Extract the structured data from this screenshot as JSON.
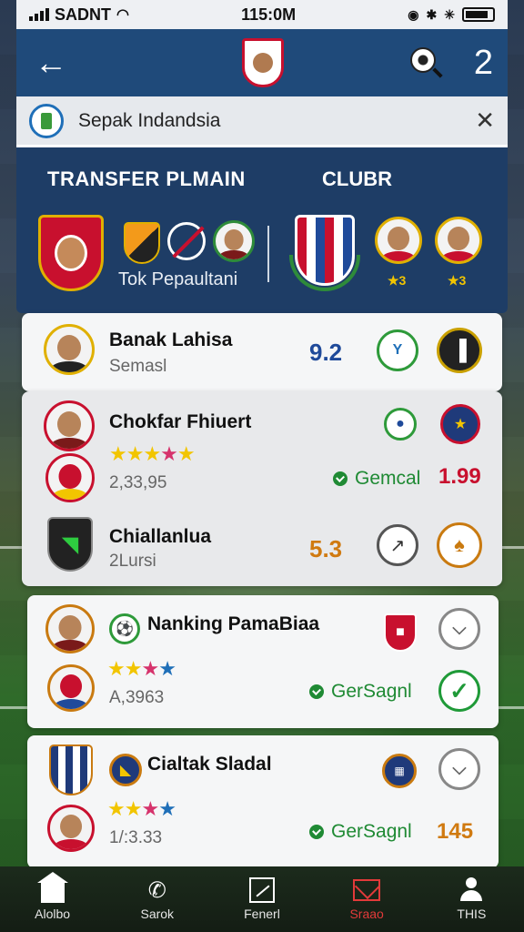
{
  "status_bar": {
    "carrier": "SADNT",
    "time": "115:0M"
  },
  "header": {
    "back_icon": "arrow-left-icon",
    "crest_icon": "club-crest-icon",
    "search_icon": "ball-search-icon",
    "count": "2"
  },
  "search": {
    "value": "Sepak Indandsia",
    "close_icon": "close-icon"
  },
  "transfer_panel": {
    "title": "TRANSFER PLMAIN",
    "club_title": "CLUBR",
    "subtitle": "Tok Pepaultani",
    "star_left": "★3",
    "star_right": "★3"
  },
  "rows": [
    {
      "name": "Banak Lahisa",
      "sub": "Semasl",
      "rating": "9.2"
    },
    {
      "name": "Chokfar Fhiuert",
      "sub": "2,33,95",
      "status": "Gemcal",
      "rating": "1.99"
    },
    {
      "name": "Chiallanlua",
      "sub": "2Lursi",
      "rating": "5.3"
    },
    {
      "name": "Nanking PamaBiaa",
      "sub": "A,3963",
      "status": "GerSagnl"
    },
    {
      "name": "Cialtak Sladal",
      "sub": "1/:3.33",
      "status": "GerSagnl",
      "rating": "145"
    }
  ],
  "nav": [
    {
      "label": "Alolbo",
      "icon": "home-icon"
    },
    {
      "label": "Sarok",
      "icon": "phone-icon"
    },
    {
      "label": "Fenerl",
      "icon": "chart-icon"
    },
    {
      "label": "Sraao",
      "icon": "mail-icon"
    },
    {
      "label": "THIS",
      "icon": "user-icon"
    }
  ],
  "colors": {
    "header_bg": "#1f4a7a",
    "panel_bg": "#1e3d66",
    "accent_red": "#c8102e",
    "accent_green": "#1f8a34",
    "star_yellow": "#f2c500"
  }
}
